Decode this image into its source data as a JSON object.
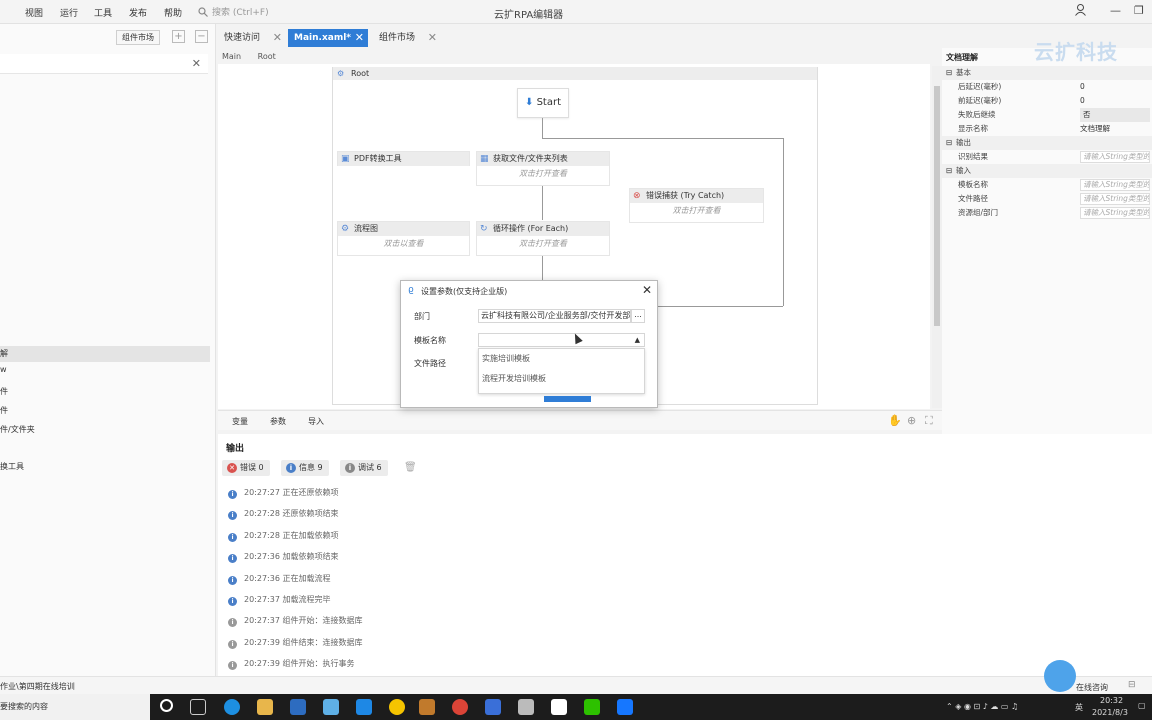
{
  "menu": [
    "视图",
    "运行",
    "工具",
    "发布",
    "帮助"
  ],
  "search_placeholder": "搜索 (Ctrl+F)",
  "app_title": "云扩RPA编辑器",
  "left": {
    "widget_market": "组件市场",
    "items": [
      "解",
      "w",
      "件",
      "件",
      "件/文件夹",
      "换工具"
    ]
  },
  "tabs": [
    {
      "label": "快速访问"
    },
    {
      "label": "Main.xaml*"
    },
    {
      "label": "组件市场"
    }
  ],
  "breadcrumb": [
    "Main",
    "Root"
  ],
  "workflow": {
    "root": "Root",
    "start": "Start",
    "nodes": {
      "pdf": {
        "title": "PDF转换工具"
      },
      "getfiles": {
        "title": "获取文件/文件夹列表",
        "body": "双击打开查看"
      },
      "flow": {
        "title": "流程图",
        "body": "双击以查看"
      },
      "foreach": {
        "title": "循环操作 (For Each)",
        "body": "双击打开查看"
      },
      "trycatch": {
        "title": "错误捕获 (Try Catch)",
        "body": "双击打开查看"
      }
    }
  },
  "canvas_bar": [
    "变量",
    "参数",
    "导入"
  ],
  "dialog": {
    "title": "设置参数(仅支持企业版)",
    "dept_label": "部门",
    "dept_value": "云扩科技有限公司/企业服务部/交付开发部",
    "dept_btn": "...",
    "template_label": "模板名称",
    "path_label": "文件路径",
    "options": [
      "实施培训模板",
      "流程开发培训模板"
    ]
  },
  "output": {
    "title": "输出",
    "filters": {
      "error": "错误 0",
      "info": "信息 9",
      "debug": "调试 6"
    },
    "logs": [
      "20:27:27 正在还原依赖项",
      "20:27:28 还原依赖项结束",
      "20:27:28 正在加载依赖项",
      "20:27:36 加载依赖项结束",
      "20:27:36 正在加载流程",
      "20:27:37 加载流程完毕",
      "20:27:37 组件开始：连接数据库",
      "20:27:39 组件结束：连接数据库",
      "20:27:39 组件开始：执行事务"
    ]
  },
  "props": {
    "title": "文档理解",
    "watermark": "云扩科技",
    "sections": [
      {
        "name": "基本",
        "rows": [
          {
            "k": "后延迟(毫秒)",
            "v": "0",
            "type": "text"
          },
          {
            "k": "前延迟(毫秒)",
            "v": "0",
            "type": "text"
          },
          {
            "k": "失败后继续",
            "v": "否",
            "type": "select"
          },
          {
            "k": "显示名称",
            "v": "文档理解",
            "type": "text"
          }
        ]
      },
      {
        "name": "输出",
        "rows": [
          {
            "k": "识别结果",
            "v": "请输入String类型的值",
            "type": "ph"
          }
        ]
      },
      {
        "name": "输入",
        "rows": [
          {
            "k": "模板名称",
            "v": "请输入String类型的值",
            "type": "ph"
          },
          {
            "k": "文件路径",
            "v": "请输入String类型的值",
            "type": "ph"
          },
          {
            "k": "资源组/部门",
            "v": "请输入String类型的值",
            "type": "ph"
          }
        ]
      }
    ]
  },
  "status": {
    "text": "作业\\第四期在线培训",
    "chat": "在线咨询"
  },
  "taskbar": {
    "search": "要搜索的内容",
    "ime": "英",
    "time": "20:32",
    "date": "2021/8/3"
  },
  "colors": {
    "accent": "#2f7dd6",
    "error": "#d9534f",
    "info": "#4a7fc8",
    "debug": "#888888"
  }
}
